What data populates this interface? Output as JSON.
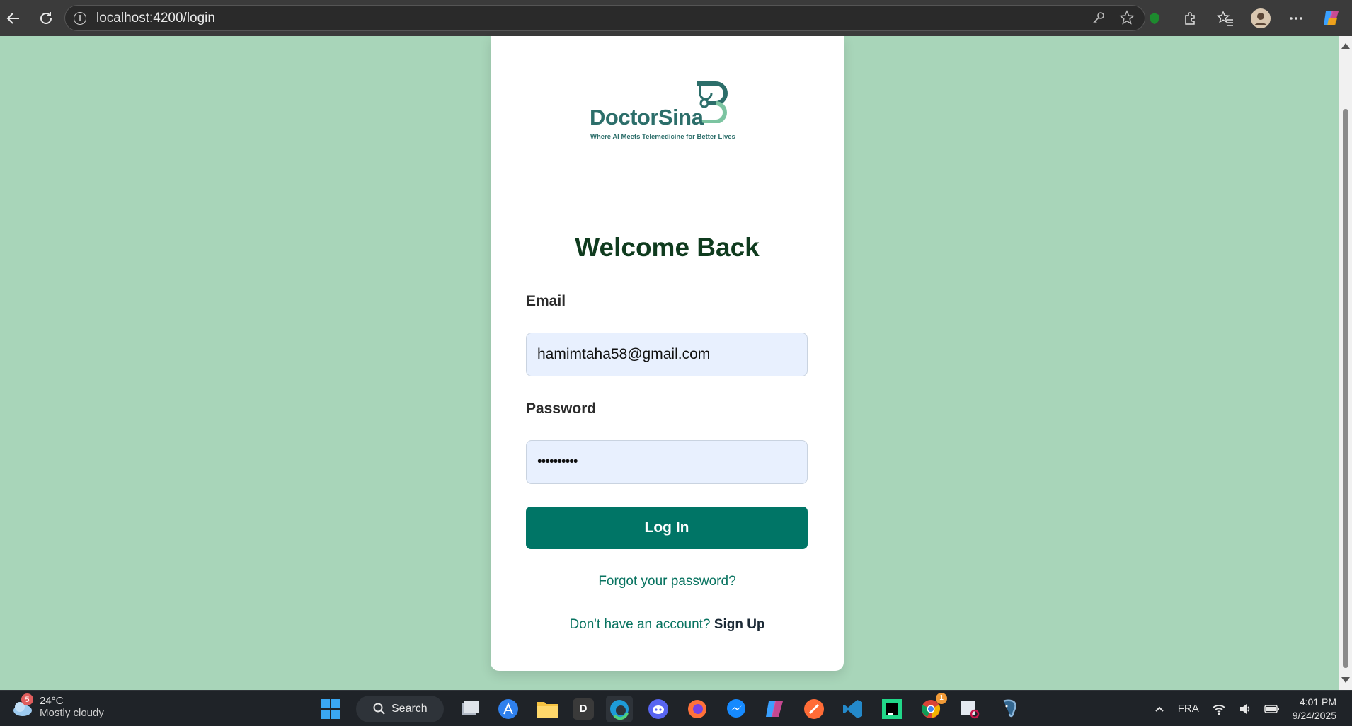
{
  "browser": {
    "url": "localhost:4200/login",
    "info_glyph": "i"
  },
  "brand": {
    "name": "DoctorSina",
    "tagline": "Where AI Meets Telemedicine for Better Lives"
  },
  "login": {
    "title": "Welcome Back",
    "email_label": "Email",
    "email_value": "hamimtaha58@gmail.com",
    "password_label": "Password",
    "password_value": "••••••••••",
    "login_button": "Log In",
    "forgot_link": "Forgot your password?",
    "signup_prompt": "Don't have an account?",
    "signup_link": "Sign Up"
  },
  "taskbar": {
    "weather_badge": "5",
    "temperature": "24°C",
    "condition": "Mostly cloudy",
    "search_label": "Search",
    "language": "FRA",
    "time": "4:01 PM",
    "date": "9/24/2025",
    "chrome_badge": "1",
    "d_app_letter": "D"
  },
  "colors": {
    "page_bg": "#a8d5b9",
    "primary": "#007566",
    "title": "#0f3b1e",
    "brand": "#2c6e6a"
  }
}
